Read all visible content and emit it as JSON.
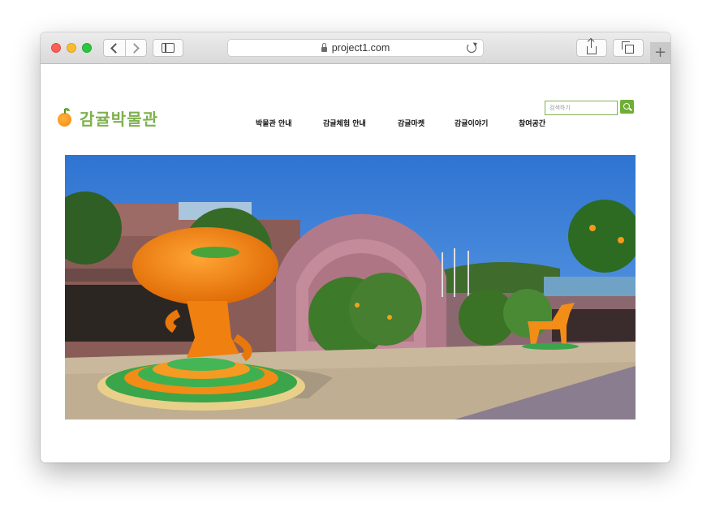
{
  "browser": {
    "url": "project1.com"
  },
  "site": {
    "logo_text": "감귤박물관",
    "search_placeholder": "검색하기",
    "nav": [
      "박물관 안내",
      "감귤체험 안내",
      "감귤마켓",
      "감귤이야기",
      "참여공간"
    ]
  },
  "icons": {
    "back": "chevron-left-icon",
    "forward": "chevron-right-icon",
    "sidebar": "sidebar-icon",
    "lock": "lock-icon",
    "reload": "reload-icon",
    "share": "share-icon",
    "tabs": "tabs-overview-icon",
    "new_tab": "plus-icon",
    "search": "search-icon",
    "logo": "orange-logo-icon"
  },
  "colors": {
    "brand_green": "#7fb04f",
    "search_button": "#6fae34",
    "sky": "#3b80d8"
  }
}
